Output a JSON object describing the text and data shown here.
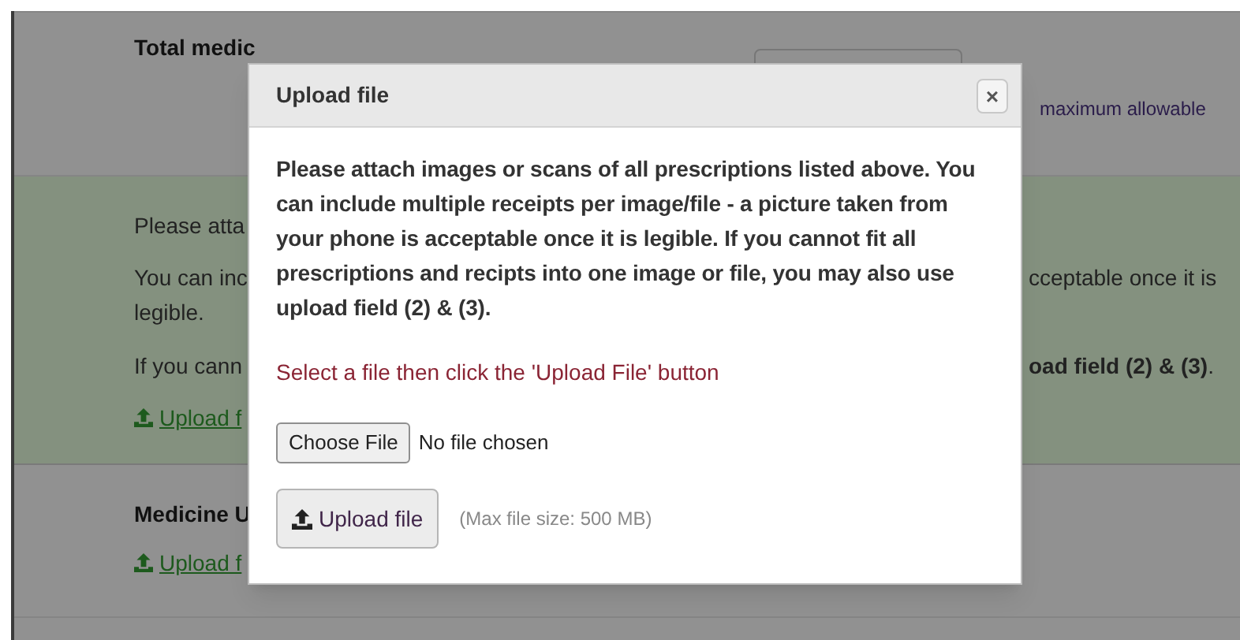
{
  "page": {
    "total_label": "Total medic",
    "max_note": "maximum allowable",
    "attach_section": {
      "lines": [
        {
          "left": "Please atta"
        },
        {
          "left": "You can inc",
          "right": "cceptable once it is"
        },
        {
          "left": "legible."
        },
        {
          "left": "If you cann",
          "right": "**oad field (2) & (3)**."
        }
      ],
      "link": "Upload f"
    },
    "medicine_section": {
      "label": "Medicine U",
      "link": "Upload f"
    }
  },
  "dialog": {
    "title": "Upload file",
    "close": "×",
    "message": "Please attach images or scans of all prescriptions listed above. You can include multiple receipts per image/file - a picture taken from your phone is acceptable once it is legible. If you cannot fit all prescriptions and recipts into one image or file, you may also use upload field (2) & (3).",
    "instruction": "Select a file then click the 'Upload File' button",
    "file_input": {
      "button": "Choose File",
      "status": "No file chosen"
    },
    "upload_button": "Upload file",
    "size_note": "(Max file size: 500 MB)"
  }
}
